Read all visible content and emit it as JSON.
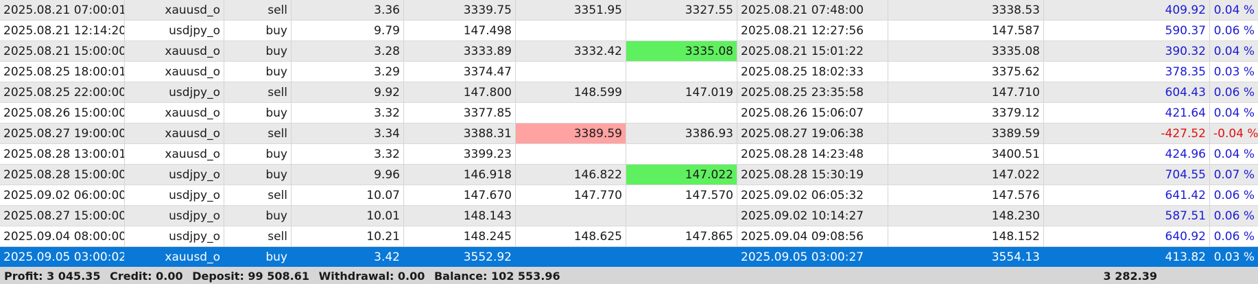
{
  "rows": [
    {
      "open_time": "2025.08.21 07:00:01",
      "symbol": "xauusd_o",
      "type": "sell",
      "volume": "3.36",
      "open_price": "3339.75",
      "sl": "3351.95",
      "tp": "3327.55",
      "close_time": "2025.08.21 07:48:00",
      "close_price": "3338.53",
      "profit": "409.92",
      "percent": "0.04 %",
      "sl_hit": false,
      "tp_hit": false
    },
    {
      "open_time": "2025.08.21 12:14:20",
      "symbol": "usdjpy_o",
      "type": "buy",
      "volume": "9.79",
      "open_price": "147.498",
      "sl": "",
      "tp": "",
      "close_time": "2025.08.21 12:27:56",
      "close_price": "147.587",
      "profit": "590.37",
      "percent": "0.06 %",
      "sl_hit": false,
      "tp_hit": false
    },
    {
      "open_time": "2025.08.21 15:00:00",
      "symbol": "xauusd_o",
      "type": "buy",
      "volume": "3.28",
      "open_price": "3333.89",
      "sl": "3332.42",
      "tp": "3335.08",
      "close_time": "2025.08.21 15:01:22",
      "close_price": "3335.08",
      "profit": "390.32",
      "percent": "0.04 %",
      "sl_hit": false,
      "tp_hit": true
    },
    {
      "open_time": "2025.08.25 18:00:01",
      "symbol": "xauusd_o",
      "type": "buy",
      "volume": "3.29",
      "open_price": "3374.47",
      "sl": "",
      "tp": "",
      "close_time": "2025.08.25 18:02:33",
      "close_price": "3375.62",
      "profit": "378.35",
      "percent": "0.03 %",
      "sl_hit": false,
      "tp_hit": false
    },
    {
      "open_time": "2025.08.25 22:00:00",
      "symbol": "usdjpy_o",
      "type": "sell",
      "volume": "9.92",
      "open_price": "147.800",
      "sl": "148.599",
      "tp": "147.019",
      "close_time": "2025.08.25 23:35:58",
      "close_price": "147.710",
      "profit": "604.43",
      "percent": "0.06 %",
      "sl_hit": false,
      "tp_hit": false
    },
    {
      "open_time": "2025.08.26 15:00:00",
      "symbol": "xauusd_o",
      "type": "buy",
      "volume": "3.32",
      "open_price": "3377.85",
      "sl": "",
      "tp": "",
      "close_time": "2025.08.26 15:06:07",
      "close_price": "3379.12",
      "profit": "421.64",
      "percent": "0.04 %",
      "sl_hit": false,
      "tp_hit": false
    },
    {
      "open_time": "2025.08.27 19:00:00",
      "symbol": "xauusd_o",
      "type": "sell",
      "volume": "3.34",
      "open_price": "3388.31",
      "sl": "3389.59",
      "tp": "3386.93",
      "close_time": "2025.08.27 19:06:38",
      "close_price": "3389.59",
      "profit": "-427.52",
      "percent": "-0.04 %",
      "sl_hit": true,
      "tp_hit": false
    },
    {
      "open_time": "2025.08.28 13:00:01",
      "symbol": "xauusd_o",
      "type": "buy",
      "volume": "3.32",
      "open_price": "3399.23",
      "sl": "",
      "tp": "",
      "close_time": "2025.08.28 14:23:48",
      "close_price": "3400.51",
      "profit": "424.96",
      "percent": "0.04 %",
      "sl_hit": false,
      "tp_hit": false
    },
    {
      "open_time": "2025.08.28 15:00:00",
      "symbol": "usdjpy_o",
      "type": "buy",
      "volume": "9.96",
      "open_price": "146.918",
      "sl": "146.822",
      "tp": "147.022",
      "close_time": "2025.08.28 15:30:19",
      "close_price": "147.022",
      "profit": "704.55",
      "percent": "0.07 %",
      "sl_hit": false,
      "tp_hit": true
    },
    {
      "open_time": "2025.09.02 06:00:00",
      "symbol": "usdjpy_o",
      "type": "sell",
      "volume": "10.07",
      "open_price": "147.670",
      "sl": "147.770",
      "tp": "147.570",
      "close_time": "2025.09.02 06:05:32",
      "close_price": "147.576",
      "profit": "641.42",
      "percent": "0.06 %",
      "sl_hit": false,
      "tp_hit": false
    },
    {
      "open_time": "2025.08.27 15:00:00",
      "symbol": "usdjpy_o",
      "type": "buy",
      "volume": "10.01",
      "open_price": "148.143",
      "sl": "",
      "tp": "",
      "close_time": "2025.09.02 10:14:27",
      "close_price": "148.230",
      "profit": "587.51",
      "percent": "0.06 %",
      "sl_hit": false,
      "tp_hit": false
    },
    {
      "open_time": "2025.09.04 08:00:00",
      "symbol": "usdjpy_o",
      "type": "sell",
      "volume": "10.21",
      "open_price": "148.245",
      "sl": "148.625",
      "tp": "147.865",
      "close_time": "2025.09.04 09:08:56",
      "close_price": "148.152",
      "profit": "640.92",
      "percent": "0.06 %",
      "sl_hit": false,
      "tp_hit": false
    },
    {
      "open_time": "2025.09.05 03:00:02",
      "symbol": "xauusd_o",
      "type": "buy",
      "volume": "3.42",
      "open_price": "3552.92",
      "sl": "",
      "tp": "",
      "close_time": "2025.09.05 03:00:27",
      "close_price": "3554.13",
      "profit": "413.82",
      "percent": "0.03 %",
      "sl_hit": false,
      "tp_hit": false,
      "selected": true
    }
  ],
  "footer": {
    "profit": "Profit: 3 045.35",
    "credit": "Credit: 0.00",
    "deposit": "Deposit: 99 508.61",
    "withdrawal": "Withdrawal: 0.00",
    "balance": "Balance: 102 553.96",
    "total_profit": "3 282.39"
  },
  "colors": {
    "row_even": "#e9e9e9",
    "row_odd": "#ffffff",
    "selected": "#0a78d7",
    "profit_positive": "#1a1ad6",
    "profit_negative": "#e01010",
    "tp_hit": "#5ff05f",
    "sl_hit": "#ffa2a2",
    "footer_bg": "#d6d6d6"
  }
}
